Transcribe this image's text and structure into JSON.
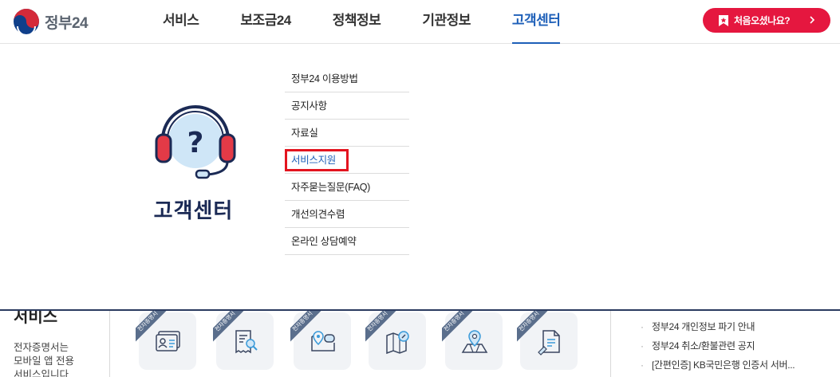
{
  "header": {
    "logo_text": "정부24",
    "nav": [
      {
        "label": "서비스",
        "active": false
      },
      {
        "label": "보조금24",
        "active": false
      },
      {
        "label": "정책정보",
        "active": false
      },
      {
        "label": "기관정보",
        "active": false
      },
      {
        "label": "고객센터",
        "active": true
      }
    ],
    "first_visit_label": "처음오셨나요?"
  },
  "mega_menu": {
    "title": "고객센터",
    "items": [
      {
        "label": "정부24 이용방법"
      },
      {
        "label": "공지사항"
      },
      {
        "label": "자료실"
      },
      {
        "label": "서비스지원",
        "highlighted": true
      },
      {
        "label": "자주묻는질문(FAQ)"
      },
      {
        "label": "개선의견수렴"
      },
      {
        "label": "온라인 상담예약"
      }
    ]
  },
  "lower": {
    "section_title": "서비스",
    "desc_lines": [
      "전자증명서는",
      "모바일 앱 전용",
      "서비스입니다"
    ],
    "card_ribbon": "전자증명서",
    "cards": [
      {
        "icon": "id-card-icon"
      },
      {
        "icon": "receipt-search-icon"
      },
      {
        "icon": "location-chat-icon"
      },
      {
        "icon": "map-compass-icon"
      },
      {
        "icon": "map-pin-icon"
      },
      {
        "icon": "document-pen-icon"
      }
    ],
    "notices": [
      "정부24 개인정보 파기 안내",
      "정부24 취소/환불관련 공지",
      "[간편인증] KB국민은행 인증서 서버..."
    ]
  },
  "colors": {
    "accent_blue": "#1d5fb8",
    "first_visit_red": "#e5173f",
    "highlight_box_red": "#e3141f",
    "title_navy": "#1b2a55"
  }
}
